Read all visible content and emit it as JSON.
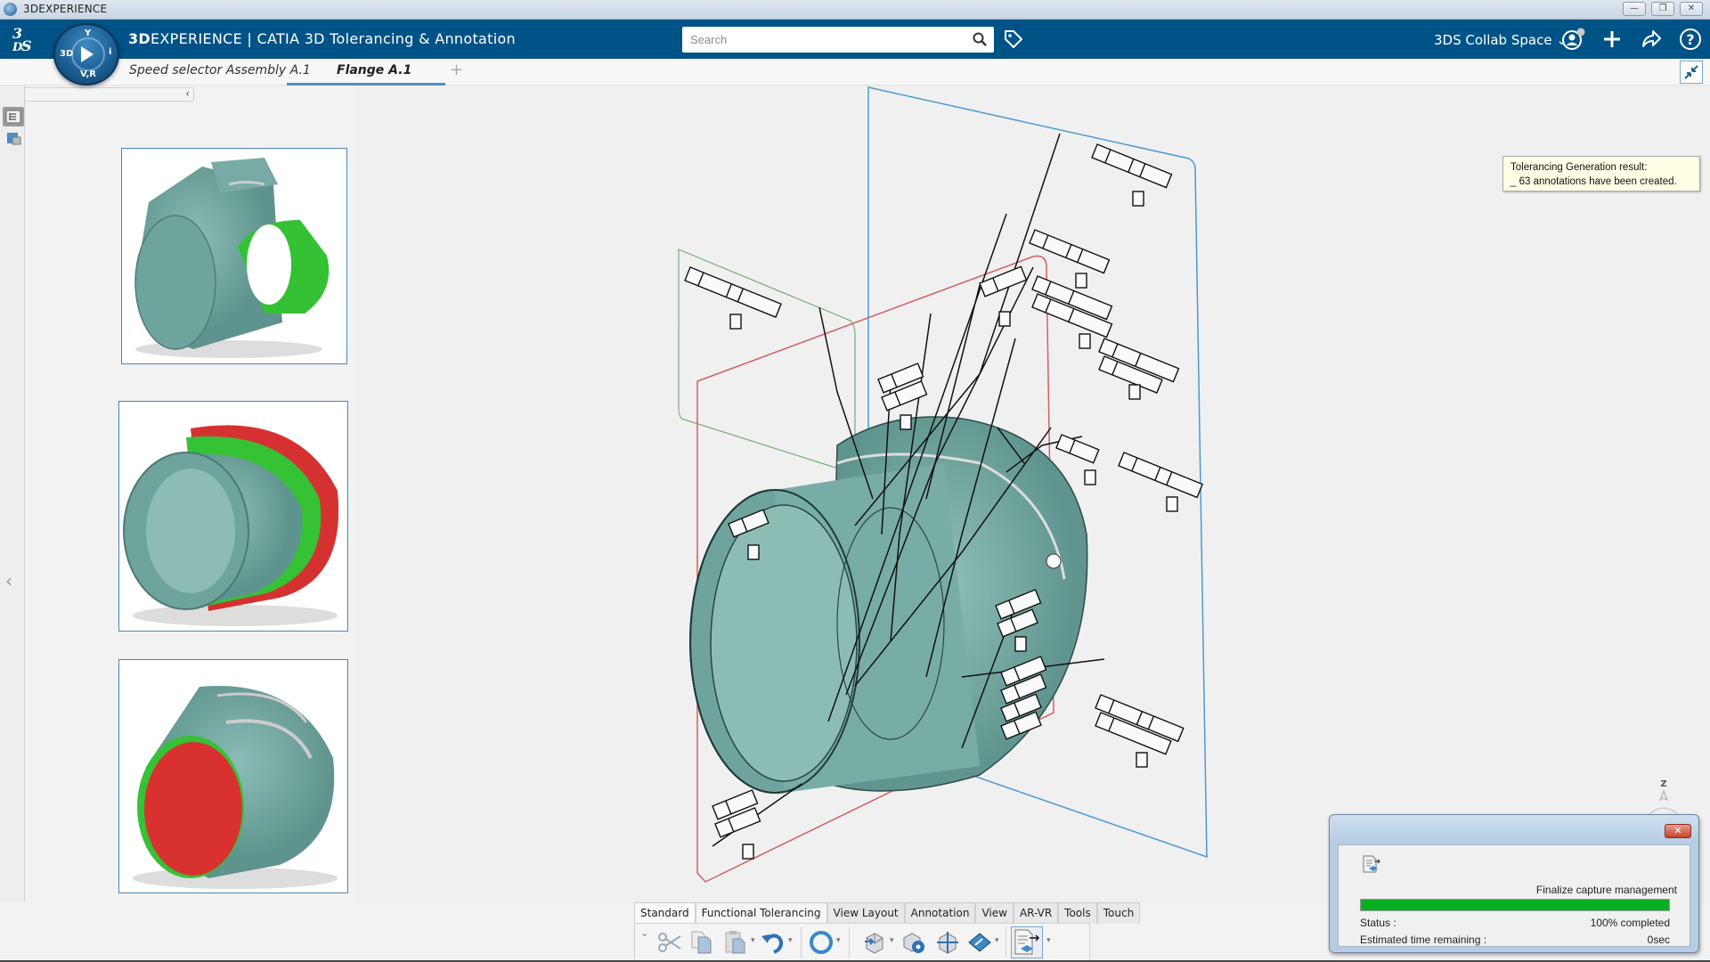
{
  "os_window": {
    "title": "3DEXPERIENCE",
    "buttons": {
      "minimize": "—",
      "restore": "❐",
      "close": "✕"
    }
  },
  "topbar": {
    "brand_bold": "3D",
    "brand_rest": "EXPERIENCE | CATIA 3D Tolerancing & Annotation",
    "compass": {
      "top": "Y",
      "left": "3D",
      "right": "i",
      "bottom": "V,R"
    },
    "search": {
      "placeholder": "Search",
      "value": ""
    },
    "collab_space": "3DS Collab Space",
    "icons": [
      "user-icon",
      "add-icon",
      "share-icon",
      "help-icon"
    ]
  },
  "tabs": {
    "items": [
      {
        "label": "Speed selector Assembly A.1",
        "active": false
      },
      {
        "label": "Flange A.1",
        "active": true
      }
    ],
    "add_label": "+"
  },
  "left_panel": {
    "collapse_glyph": "‹",
    "expand_glyph": "‹",
    "thumbnails": [
      {
        "name": "flange-view-1",
        "highlight": "green bore"
      },
      {
        "name": "flange-view-2",
        "highlight": "green and red outer rings"
      },
      {
        "name": "flange-view-3",
        "highlight": "red inner bore"
      }
    ]
  },
  "viewport": {
    "annotation_count": 63,
    "axis_label": "Z"
  },
  "tooltip": {
    "line1": "Tolerancing Generation result:",
    "line2": "_ 63 annotations have been created."
  },
  "progress_dialog": {
    "step": "Finalize capture management",
    "progress_percent": 100,
    "status_label": "Status :",
    "status_value": "100% completed",
    "eta_label": "Estimated time remaining :",
    "eta_value": "0sec",
    "close_label": "✕"
  },
  "action_bar": {
    "tabs": [
      "Standard",
      "Functional Tolerancing",
      "View Layout",
      "Annotation",
      "View",
      "AR-VR",
      "Tools",
      "Touch"
    ],
    "active_tab": "Standard",
    "tools": [
      "cut",
      "copy",
      "paste",
      "undo",
      "update",
      "semantic-tolerancing",
      "tolerancing-advisor",
      "datum-system",
      "geometry-tolerance",
      "capture-management"
    ]
  },
  "colors": {
    "topbar": "#005386",
    "accent": "#4d8fc2",
    "part": "#6fa7a0",
    "highlight_green": "#33cc33",
    "highlight_red": "#d93030",
    "progress": "#06b025"
  }
}
